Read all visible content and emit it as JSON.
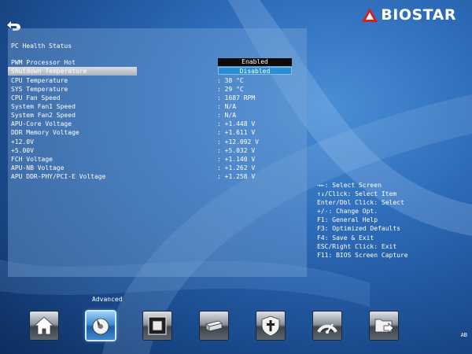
{
  "brand": {
    "name": "BIOSTAR"
  },
  "panel": {
    "title": "PC Health Status"
  },
  "options": [
    {
      "label": "PWM Processor Hot",
      "value": "Enabled"
    },
    {
      "label": "Shutdown Temperature",
      "value": "Disabled"
    }
  ],
  "readings": [
    {
      "label": "CPU Temperature",
      "value": ": 38 °C"
    },
    {
      "label": "SYS Temperature",
      "value": ": 29 °C"
    },
    {
      "label": "CPU Fan Speed",
      "value": ": 1687 RPM"
    },
    {
      "label": "System Fan1 Speed",
      "value": ": N/A"
    },
    {
      "label": "System Fan2 Speed",
      "value": ": N/A"
    },
    {
      "label": "APU-Core Voltage",
      "value": ": +1.448 V"
    },
    {
      "label": "DDR Memory Voltage",
      "value": ": +1.611 V"
    },
    {
      "label": "+12.0V",
      "value": ": +12.092 V"
    },
    {
      "label": "+5.00V",
      "value": ": +5.032 V"
    },
    {
      "label": "FCH Voltage",
      "value": ": +1.140 V"
    },
    {
      "label": "APU-NB Voltage",
      "value": ": +1.262 V"
    },
    {
      "label": "APU DDR-PHY/PCI-E Voltage",
      "value": ": +1.258 V"
    }
  ],
  "help": [
    "→←: Select Screen",
    "↑↓/Click: Select Item",
    "Enter/Dbl Click: Select",
    "+/-: Change Opt.",
    "F1: General Help",
    "F3: Optimized Defaults",
    "F4: Save & Exit",
    "ESC/Right Click: Exit",
    "F11: BIOS Screen Capture"
  ],
  "menu": {
    "active_caption": "Advanced",
    "items": [
      {
        "icon": "home-icon",
        "active": false
      },
      {
        "icon": "advanced-icon",
        "active": true
      },
      {
        "icon": "chipset-icon",
        "active": false
      },
      {
        "icon": "boot-icon",
        "active": false
      },
      {
        "icon": "security-icon",
        "active": false
      },
      {
        "icon": "o-n-e-icon",
        "active": false
      },
      {
        "icon": "save-exit-icon",
        "active": false
      }
    ]
  },
  "footer": {
    "corner": "AB"
  },
  "colors": {
    "highlight_enabled": "#0a0a0a",
    "highlight_disabled": "#2a8fd0",
    "accent_red": "#d11f26"
  }
}
